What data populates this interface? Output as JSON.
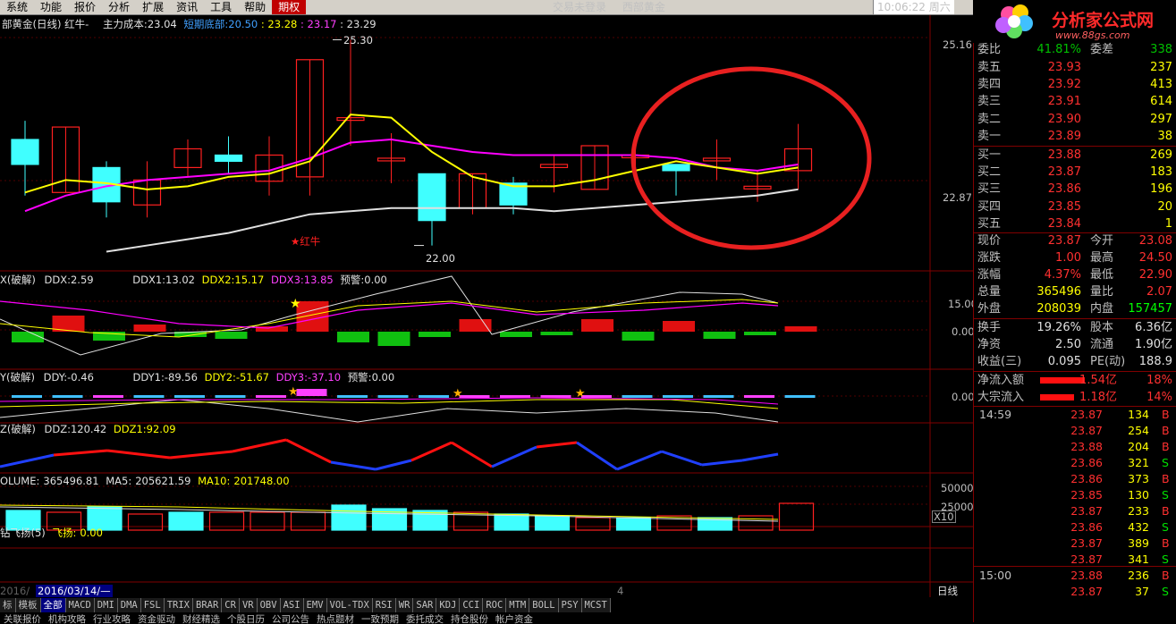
{
  "menu": {
    "items": [
      "系统",
      "功能",
      "报价",
      "分析",
      "扩展",
      "资讯",
      "工具",
      "帮助",
      "期权"
    ],
    "active_index": 8,
    "status_text": "交易未登录",
    "stock_title": "西部黄金",
    "clock": "10:06:22 周六"
  },
  "logo": {
    "site_name": "分析家公式网",
    "url": "www.88gs.com"
  },
  "main_chart": {
    "header": {
      "title": "部黄金(日线) 红牛-",
      "cost_label": "主力成本:",
      "cost_value": "23.04",
      "bottom_label": "短期底部:",
      "bottom_value": "20.50",
      "v1": "23.28",
      "v2": "23.17",
      "v3": "23.29"
    },
    "y_ticks": [
      "25.16",
      "22.87"
    ],
    "annotations": {
      "high": "25.30",
      "low": "22.00",
      "signal": "★红牛"
    },
    "candles": [
      {
        "o": 23.7,
        "c": 23.3,
        "h": 24.0,
        "l": 22.8
      },
      {
        "o": 22.85,
        "c": 23.9,
        "h": 23.9,
        "l": 22.85
      },
      {
        "o": 23.25,
        "c": 22.7,
        "h": 23.35,
        "l": 22.45
      },
      {
        "o": 22.65,
        "c": 23.05,
        "h": 23.35,
        "l": 22.45
      },
      {
        "o": 23.25,
        "c": 23.55,
        "h": 23.7,
        "l": 23.1
      },
      {
        "o": 23.45,
        "c": 23.35,
        "h": 23.75,
        "l": 23.15
      },
      {
        "o": 23.03,
        "c": 23.45,
        "h": 23.75,
        "l": 22.8
      },
      {
        "o": 23.1,
        "c": 24.98,
        "h": 24.98,
        "l": 22.8
      },
      {
        "o": 24.05,
        "c": 24.05,
        "h": 25.3,
        "l": 23.6
      },
      {
        "o": 23.4,
        "c": 23.4,
        "h": 23.8,
        "l": 23.0
      },
      {
        "o": 23.15,
        "c": 22.4,
        "h": 23.15,
        "l": 22.0
      },
      {
        "o": 22.6,
        "c": 23.15,
        "h": 23.15,
        "l": 22.5
      },
      {
        "o": 23.0,
        "c": 22.65,
        "h": 23.1,
        "l": 22.5
      },
      {
        "o": 23.25,
        "c": 23.3,
        "h": 23.45,
        "l": 22.85
      },
      {
        "o": 22.9,
        "c": 23.6,
        "h": 23.6,
        "l": 22.9
      },
      {
        "o": 23.45,
        "c": 23.45,
        "h": 23.75,
        "l": 23.2
      },
      {
        "o": 23.3,
        "c": 23.2,
        "h": 23.3,
        "l": 22.8
      },
      {
        "o": 23.4,
        "c": 23.4,
        "h": 23.7,
        "l": 23.05
      },
      {
        "o": 22.95,
        "c": 22.95,
        "h": 23.2,
        "l": 22.7
      },
      {
        "o": 23.2,
        "c": 23.55,
        "h": 23.95,
        "l": 22.9
      }
    ],
    "ma_yellow": [
      22.85,
      23.05,
      23.0,
      22.9,
      22.95,
      23.1,
      23.15,
      23.35,
      24.1,
      24.05,
      23.5,
      23.1,
      22.95,
      22.95,
      23.05,
      23.2,
      23.35,
      23.25,
      23.15,
      23.25
    ],
    "ma_magenta": [
      22.55,
      22.8,
      22.95,
      23.05,
      23.1,
      23.15,
      23.2,
      23.4,
      23.65,
      23.7,
      23.6,
      23.5,
      23.45,
      23.45,
      23.45,
      23.45,
      23.4,
      23.25,
      23.2,
      23.3
    ],
    "ma_white": [
      null,
      null,
      21.9,
      22.0,
      22.1,
      22.2,
      22.35,
      22.5,
      22.55,
      22.6,
      22.6,
      22.6,
      22.6,
      22.55,
      22.6,
      22.65,
      22.7,
      22.75,
      22.8,
      22.9
    ]
  },
  "ddx_panel": {
    "label": "X(破解)",
    "ddx_label": "DDX:",
    "ddx_value": "2.59",
    "ddx1_label": "DDX1:",
    "ddx1_value": "13.02",
    "ddx2_label": "DDX2:",
    "ddx2_value": "15.17",
    "ddx3_label": "DDX3:",
    "ddx3_value": "13.85",
    "warn_label": "预警:",
    "warn_value": "0.00",
    "y_ticks": [
      "15.00",
      "0.00"
    ]
  },
  "ddy_panel": {
    "label": "Y(破解)",
    "ddy_label": "DDY:",
    "ddy_value": "-0.46",
    "ddy1_label": "DDY1:",
    "ddy1_value": "-89.56",
    "ddy2_label": "DDY2:",
    "ddy2_value": "-51.67",
    "ddy3_label": "DDY3:",
    "ddy3_value": "-37.10",
    "warn_label": "预警:",
    "warn_value": "0.00",
    "y_ticks": [
      "0.00"
    ]
  },
  "ddz_panel": {
    "label": "Z(破解)",
    "ddz_label": "DDZ:",
    "ddz_value": "120.42",
    "ddz1_label": "DDZ1:",
    "ddz1_value": "92.09"
  },
  "volume_panel": {
    "vol_label": "OLUME:",
    "vol_value": "365496.81",
    "ma5_label": "MA5:",
    "ma5_value": "205621.59",
    "ma10_label": "MA10:",
    "ma10_value": "201748.00",
    "y_ticks": [
      "50000",
      "25000"
    ],
    "scale": "X10"
  },
  "fly_panel": {
    "label": "钻飞扬(5)",
    "fly_label": "飞扬:",
    "fly_value": "0.00"
  },
  "date_bar": {
    "left": "2016/",
    "date": "2016/03/14/—",
    "marker": "4"
  },
  "right_panel": {
    "commission_label": "委比",
    "commission_value": "41.81%",
    "commission_diff_label": "委差",
    "commission_diff_value": "338",
    "asks": [
      {
        "label": "卖五",
        "price": "23.93",
        "vol": "237"
      },
      {
        "label": "卖四",
        "price": "23.92",
        "vol": "413"
      },
      {
        "label": "卖三",
        "price": "23.91",
        "vol": "614"
      },
      {
        "label": "卖二",
        "price": "23.90",
        "vol": "297"
      },
      {
        "label": "卖一",
        "price": "23.89",
        "vol": "38"
      }
    ],
    "bids": [
      {
        "label": "买一",
        "price": "23.88",
        "vol": "269"
      },
      {
        "label": "买二",
        "price": "23.87",
        "vol": "183"
      },
      {
        "label": "买三",
        "price": "23.86",
        "vol": "196"
      },
      {
        "label": "买四",
        "price": "23.85",
        "vol": "20"
      },
      {
        "label": "买五",
        "price": "23.84",
        "vol": "1"
      }
    ],
    "stats": [
      {
        "l1": "现价",
        "v1": "23.87",
        "l2": "今开",
        "v2": "23.08"
      },
      {
        "l1": "涨跌",
        "v1": "1.00",
        "l2": "最高",
        "v2": "24.50"
      },
      {
        "l1": "涨幅",
        "v1": "4.37%",
        "l2": "最低",
        "v2": "22.90"
      },
      {
        "l1": "总量",
        "v1": "365496",
        "l2": "量比",
        "v2": "2.07"
      },
      {
        "l1": "外盘",
        "v1": "208039",
        "l2": "内盘",
        "v2": "157457"
      }
    ],
    "stats2": [
      {
        "l1": "换手",
        "v1": "19.26%",
        "l2": "股本",
        "v2": "6.36亿"
      },
      {
        "l1": "净资",
        "v1": "2.50",
        "l2": "流通",
        "v2": "1.90亿"
      },
      {
        "l1": "收益(三)",
        "v1": "0.095",
        "l2": "PE(动)",
        "v2": "188.9"
      }
    ],
    "flows": [
      {
        "label": "净流入额",
        "value": "1.54亿",
        "pct": "18%"
      },
      {
        "label": "大宗流入",
        "value": "1.18亿",
        "pct": "14%"
      }
    ],
    "ticks": [
      {
        "time": "14:59",
        "price": "23.87",
        "vol": "134",
        "dir": "B"
      },
      {
        "time": "",
        "price": "23.87",
        "vol": "254",
        "dir": "B"
      },
      {
        "time": "",
        "price": "23.88",
        "vol": "204",
        "dir": "B"
      },
      {
        "time": "",
        "price": "23.86",
        "vol": "321",
        "dir": "S"
      },
      {
        "time": "",
        "price": "23.86",
        "vol": "373",
        "dir": "B"
      },
      {
        "time": "",
        "price": "23.85",
        "vol": "130",
        "dir": "S"
      },
      {
        "time": "",
        "price": "23.87",
        "vol": "233",
        "dir": "B"
      },
      {
        "time": "",
        "price": "23.86",
        "vol": "432",
        "dir": "S"
      },
      {
        "time": "",
        "price": "23.87",
        "vol": "389",
        "dir": "B"
      },
      {
        "time": "",
        "price": "23.87",
        "vol": "341",
        "dir": "S"
      },
      {
        "time": "15:00",
        "price": "23.88",
        "vol": "236",
        "dir": "B"
      },
      {
        "time": "",
        "price": "23.87",
        "vol": "37",
        "dir": "S"
      }
    ],
    "period_label": "日线"
  },
  "indicator_tabs": [
    "标",
    "模板",
    "全部",
    "MACD",
    "DMI",
    "DMA",
    "FSL",
    "TRIX",
    "BRAR",
    "CR",
    "VR",
    "OBV",
    "ASI",
    "EMV",
    "VOL-TDX",
    "RSI",
    "WR",
    "SAR",
    "KDJ",
    "CCI",
    "ROC",
    "MTM",
    "BOLL",
    "PSY",
    "MCST"
  ],
  "indicator_active": 2,
  "bottom_tabs": [
    "关联报价",
    "机构攻略",
    "行业攻略",
    "资金驱动",
    "财经精选",
    "个股日历",
    "公司公告",
    "热点题材",
    "一致预期",
    "委托成交",
    "持仓股份",
    "帐户资金"
  ],
  "colors": {
    "up": "#ff2020",
    "down": "#40ffff",
    "yellow": "#ffff00",
    "magenta": "#ff00ff",
    "grid": "#800000"
  }
}
